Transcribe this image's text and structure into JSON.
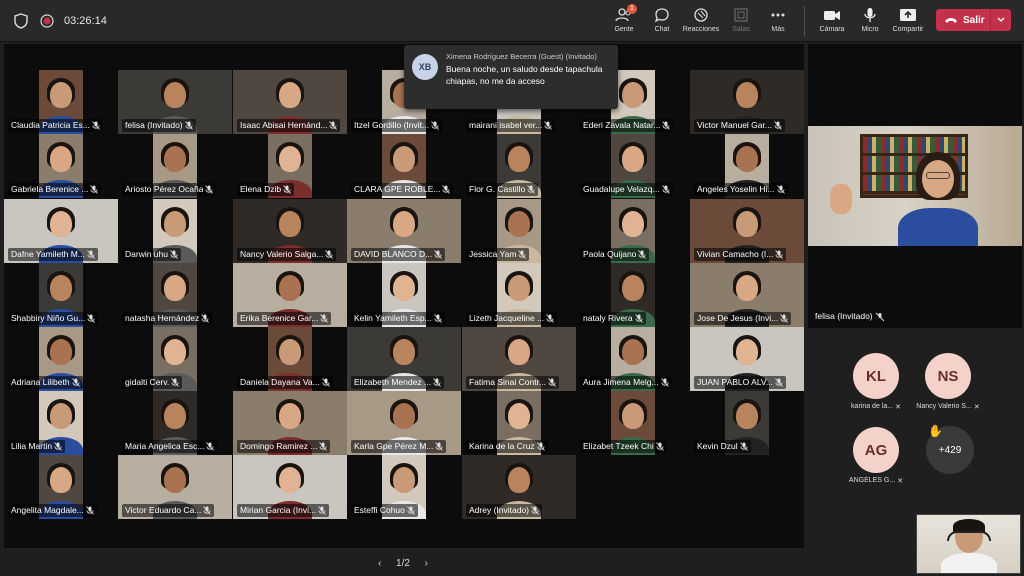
{
  "topbar": {
    "time": "03:26:14",
    "buttons": [
      {
        "label": "Gente",
        "icon": "people-icon",
        "badge": "1"
      },
      {
        "label": "Chat",
        "icon": "chat-icon"
      },
      {
        "label": "Reacciones",
        "icon": "reactions-icon"
      },
      {
        "label": "Salas",
        "icon": "rooms-icon",
        "disabled": true
      },
      {
        "label": "Más",
        "icon": "more-icon"
      },
      {
        "label": "Cámara",
        "icon": "camera-icon"
      },
      {
        "label": "Micro",
        "icon": "mic-icon"
      },
      {
        "label": "Compartir",
        "icon": "share-icon"
      }
    ],
    "leave_label": "Salir"
  },
  "notification": {
    "initials": "XB",
    "sender": "Ximena Rodríguez Becerra (Guest) (Invitado)",
    "message": "Buena noche, un saludo desde tapachula chiapas, no me da acceso"
  },
  "participants": [
    "Claudia Patricia Es...",
    "felisa (Invitado)",
    "Isaac Abisai Hernánd...",
    "Itzel Gordillo (Invit...",
    "mairani isabel ver...",
    "Ederi Zavala Natar...",
    "Victor Manuel Gar...",
    "Gabriela Berenice ...",
    "Ariosto Pérez Ocaña",
    "Elena Dzib",
    "CLARA GPE ROBLE...",
    "Flor G. Castillo",
    "Guadalupe Velazq...",
    "Angeles Yoselin Hi...",
    "Dafne Yamileth M...",
    "Darwin uhu",
    "Nancy Valerio Salga...",
    "DAVID BLANCO D...",
    "Jessica Yam",
    "Paola Quijano",
    "Vivian Camacho (I...",
    "Shabbiry Niño Gu...",
    "natasha Hernández",
    "Erika Berenice Gar...",
    "Kelin Yamileth Esp...",
    "Lizeth Jacqueline ...",
    "nataly Rivera",
    "Jose De Jesus (Invi...",
    "Adriana Lilibeth",
    "gidalti Cerv.",
    "Daniela Dayana Va...",
    "Elizabeth Mendez ...",
    "Fatima Sinai Contr...",
    "Aura Jimena Melg...",
    "JUAN PABLO ALV...",
    "Lilia Martin",
    "Maria Angelica Esc...",
    "Domingo Ramirez ...",
    "Karla Gpe Pérez M...",
    "Karina de la Cruz",
    "Elizabet Tzeek Chi",
    "Kevin Dzul",
    "Angelita Magdale...",
    "Victor Eduardo Ca...",
    "Mirian Garcia (Invi...",
    "Esteffi Cohuo",
    "Adrey (Invitado)"
  ],
  "spotlight": {
    "name": "felisa (Invitado)"
  },
  "people_circles": [
    {
      "initials": "KL",
      "name": "karina de la..."
    },
    {
      "initials": "NS",
      "name": "Nancy Valerio S..."
    },
    {
      "initials": "AG",
      "name": "ANGELES G..."
    }
  ],
  "more_count": "+429",
  "pager": "1/2",
  "colors": {
    "leave": "#c4314b",
    "badge": "#e25b3e",
    "circle_bg": "#f5d2c9"
  }
}
